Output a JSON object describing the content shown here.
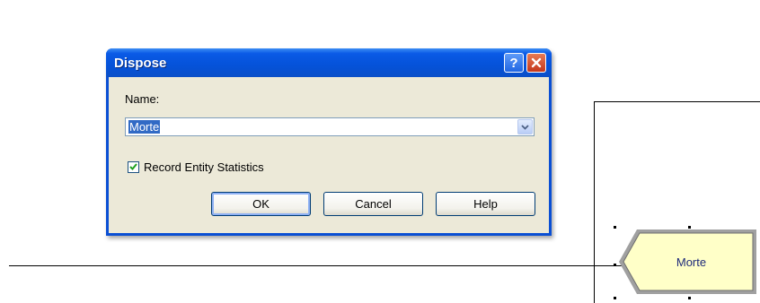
{
  "dialog": {
    "title": "Dispose",
    "titlebar_help_glyph": "?",
    "name_label": "Name:",
    "name_value": "Morte",
    "record_stats_label": "Record Entity Statistics",
    "record_stats_checked": true,
    "buttons": {
      "ok": "OK",
      "cancel": "Cancel",
      "help": "Help"
    }
  },
  "canvas": {
    "module_label": "Morte"
  },
  "icons": {
    "titlebar_help": "question-mark-icon",
    "titlebar_close": "close-icon",
    "dropdown": "chevron-down-icon",
    "check": "check-icon"
  },
  "colors": {
    "titlebar_blue": "#0a52d9",
    "close_red": "#c4371c",
    "dialog_face": "#ece9d8",
    "selection": "#316ac5",
    "module_fill": "#ffffc8",
    "module_border": "#808080",
    "module_text": "#1e2a7a"
  }
}
